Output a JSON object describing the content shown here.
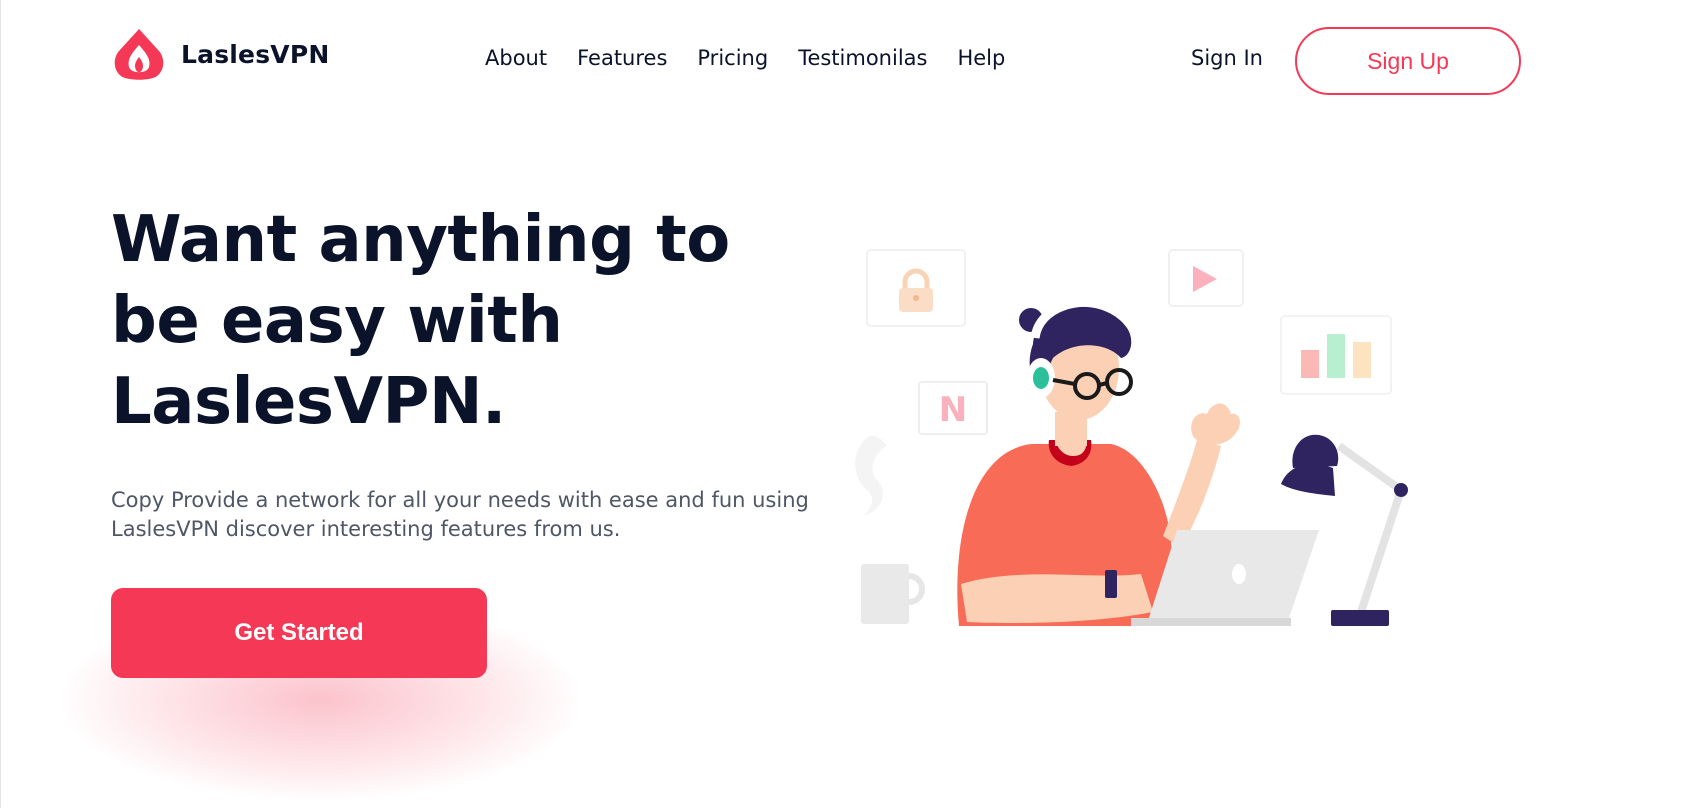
{
  "brand": {
    "name": "LaslesVPN",
    "accent": "#f53855"
  },
  "nav": {
    "items": [
      "About",
      "Features",
      "Pricing",
      "Testimonilas",
      "Help"
    ]
  },
  "auth": {
    "sign_in": "Sign In",
    "sign_up": "Sign Up"
  },
  "hero": {
    "title": "Want anything to be easy with LaslesVPN.",
    "subtitle": "Copy Provide a network for all your needs with ease and fun using LaslesVPN discover interesting features from us.",
    "cta": "Get Started"
  },
  "illustration": {
    "badge_letter": "N",
    "icons": [
      "lock-icon",
      "play-icon",
      "bar-chart-icon",
      "netflix-icon",
      "mug-icon",
      "desk-lamp-icon",
      "laptop-icon"
    ]
  }
}
